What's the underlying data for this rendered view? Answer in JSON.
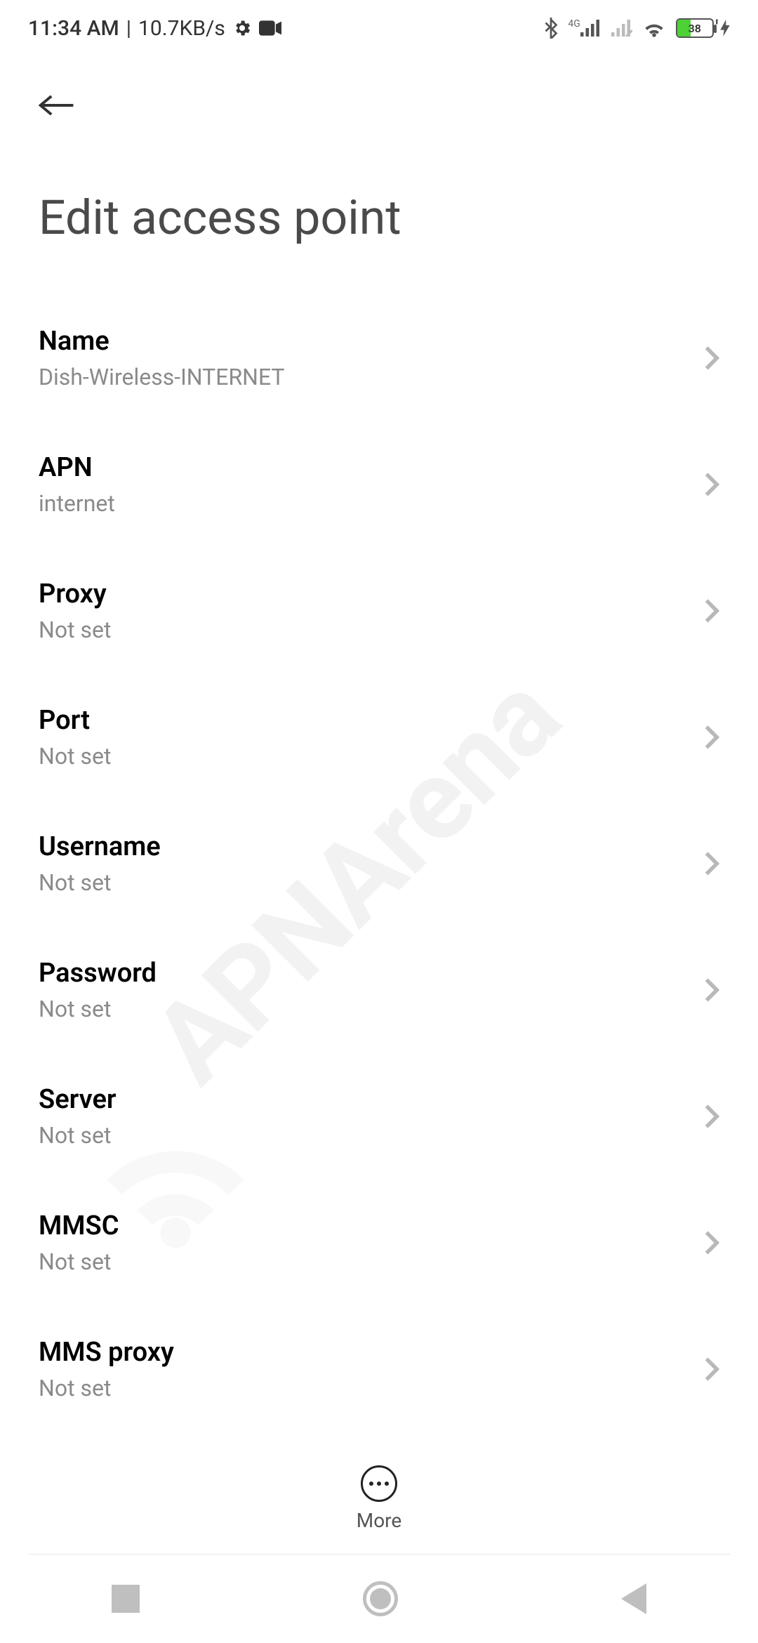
{
  "status": {
    "time": "11:34 AM",
    "data_rate": "10.7KB/s",
    "network_label": "4G",
    "battery_pct": "38"
  },
  "header": {
    "title": "Edit access point"
  },
  "rows": [
    {
      "label": "Name",
      "value": "Dish-Wireless-INTERNET"
    },
    {
      "label": "APN",
      "value": "internet"
    },
    {
      "label": "Proxy",
      "value": "Not set"
    },
    {
      "label": "Port",
      "value": "Not set"
    },
    {
      "label": "Username",
      "value": "Not set"
    },
    {
      "label": "Password",
      "value": "Not set"
    },
    {
      "label": "Server",
      "value": "Not set"
    },
    {
      "label": "MMSC",
      "value": "Not set"
    },
    {
      "label": "MMS proxy",
      "value": "Not set"
    }
  ],
  "bottom": {
    "more_label": "More"
  },
  "watermark": {
    "text": "APNArena"
  }
}
